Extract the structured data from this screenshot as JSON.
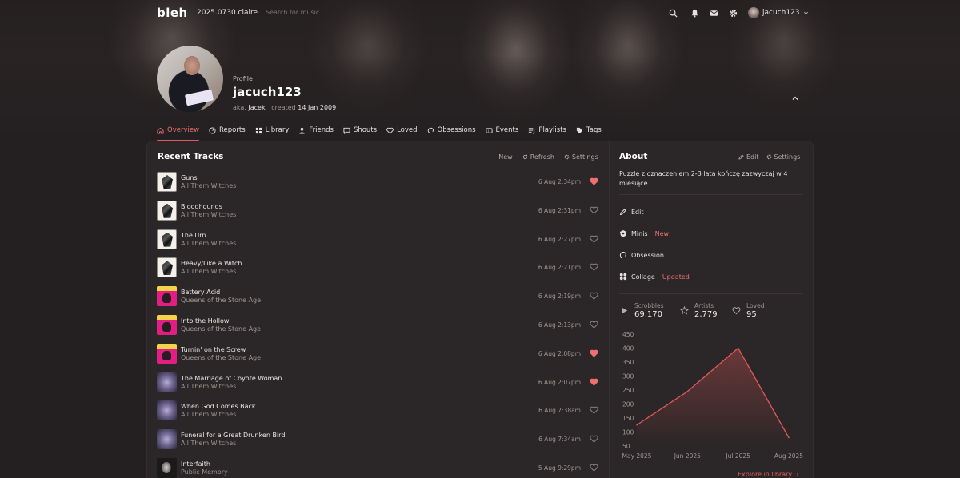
{
  "topbar": {
    "logo": "bleh",
    "version": "2025.0730.claire",
    "search_placeholder": "Search for music...",
    "username": "jacuch123",
    "icons": [
      "search-icon",
      "bell-icon",
      "mail-icon",
      "gear-icon"
    ]
  },
  "profile": {
    "label": "Profile",
    "name": "jacuch123",
    "aka_label": "aka.",
    "aka": "Jacek",
    "created_label": "created",
    "created": "14 Jan 2009"
  },
  "tabs": [
    {
      "label": "Overview",
      "icon": "home-icon",
      "active": true
    },
    {
      "label": "Reports",
      "icon": "reports-icon"
    },
    {
      "label": "Library",
      "icon": "grid-icon"
    },
    {
      "label": "Friends",
      "icon": "person-icon"
    },
    {
      "label": "Shouts",
      "icon": "chat-icon"
    },
    {
      "label": "Loved",
      "icon": "heart-icon"
    },
    {
      "label": "Obsessions",
      "icon": "obsession-icon"
    },
    {
      "label": "Events",
      "icon": "ticket-icon"
    },
    {
      "label": "Playlists",
      "icon": "playlist-icon"
    },
    {
      "label": "Tags",
      "icon": "tag-icon"
    }
  ],
  "recent_tracks": {
    "title": "Recent Tracks",
    "actions": [
      "+ New",
      "Refresh",
      "Settings"
    ],
    "items": [
      {
        "name": "Guns",
        "artist": "All Them Witches",
        "time": "6 Aug 2:34pm",
        "loved": true,
        "cover": "atw"
      },
      {
        "name": "Bloodhounds",
        "artist": "All Them Witches",
        "time": "6 Aug 2:31pm",
        "loved": false,
        "cover": "atw"
      },
      {
        "name": "The Urn",
        "artist": "All Them Witches",
        "time": "6 Aug 2:27pm",
        "loved": false,
        "cover": "atw"
      },
      {
        "name": "Heavy/Like a Witch",
        "artist": "All Them Witches",
        "time": "6 Aug 2:21pm",
        "loved": false,
        "cover": "atw"
      },
      {
        "name": "Battery Acid",
        "artist": "Queens of the Stone Age",
        "time": "6 Aug 2:19pm",
        "loved": false,
        "cover": "qotsa"
      },
      {
        "name": "Into the Hollow",
        "artist": "Queens of the Stone Age",
        "time": "6 Aug 2:13pm",
        "loved": false,
        "cover": "qotsa"
      },
      {
        "name": "Turnin' on the Screw",
        "artist": "Queens of the Stone Age",
        "time": "6 Aug 2:08pm",
        "loved": true,
        "cover": "qotsa"
      },
      {
        "name": "The Marriage of Coyote Woman",
        "artist": "All Them Witches",
        "time": "6 Aug 2:07pm",
        "loved": true,
        "cover": "atw2"
      },
      {
        "name": "When God Comes Back",
        "artist": "All Them Witches",
        "time": "6 Aug 7:38am",
        "loved": false,
        "cover": "atw2"
      },
      {
        "name": "Funeral for a Great Drunken Bird",
        "artist": "All Them Witches",
        "time": "6 Aug 7:34am",
        "loved": false,
        "cover": "atw2"
      },
      {
        "name": "Interfaith",
        "artist": "Public Memory",
        "time": "5 Aug 9:29pm",
        "loved": false,
        "cover": "pm"
      }
    ]
  },
  "about": {
    "title": "About",
    "edit_label": "Edit",
    "settings_label": "Settings",
    "bio": "Puzzle z oznaczeniem 2-3 lata kończę zazwyczaj w 4 miesiące.",
    "items": [
      {
        "label": "Edit",
        "icon": "pencil-icon",
        "tag": ""
      },
      {
        "label": "Minis",
        "icon": "minis-icon",
        "tag": "New"
      },
      {
        "label": "Obsession",
        "icon": "obsession-icon",
        "tag": ""
      },
      {
        "label": "Collage",
        "icon": "collage-icon",
        "tag": "Updated"
      }
    ],
    "stats": [
      {
        "label": "Scrobbles",
        "value": "69,170",
        "icon": "play-icon"
      },
      {
        "label": "Artists",
        "value": "2,779",
        "icon": "star-icon"
      },
      {
        "label": "Loved",
        "value": "95",
        "icon": "heart-icon"
      }
    ],
    "explore_label": "Explore in library"
  },
  "colors": {
    "accent": "#e05a5a",
    "background": "#242021",
    "panel": "#2b2627"
  },
  "chart_data": {
    "type": "area",
    "x": [
      "May 2025",
      "Jun 2025",
      "Jul 2025",
      "Aug 2025"
    ],
    "points": [
      {
        "x": "May 2025",
        "y": 125
      },
      {
        "x": "Jun 2025",
        "y": 245
      },
      {
        "x": "Jul 2025",
        "y": 400
      },
      {
        "x": "Aug 2025",
        "y": 80
      }
    ],
    "yticks": [
      450,
      400,
      350,
      300,
      250,
      200,
      150,
      100,
      50
    ],
    "ylim": [
      50,
      450
    ],
    "grid": false,
    "line_color": "#e05a5a"
  }
}
